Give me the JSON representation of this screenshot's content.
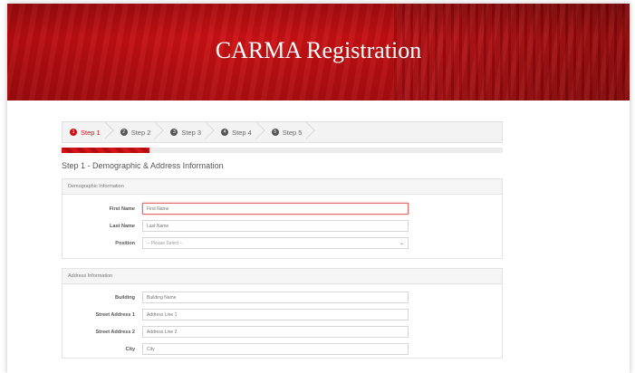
{
  "header": {
    "title": "CARMA Registration"
  },
  "steps": [
    {
      "number": "1",
      "label": "Step 1"
    },
    {
      "number": "2",
      "label": "Step 2"
    },
    {
      "number": "3",
      "label": "Step 3"
    },
    {
      "number": "4",
      "label": "Step 4"
    },
    {
      "number": "5",
      "label": "Step 5"
    }
  ],
  "progress": {
    "fraction": 0.2
  },
  "section_title": "Step 1 - Demographic & Address Information",
  "demographic": {
    "heading": "Demographic Information",
    "first_name": {
      "label": "First Name",
      "placeholder": "First Name",
      "value": ""
    },
    "last_name": {
      "label": "Last Name",
      "placeholder": "Last Name",
      "value": ""
    },
    "position": {
      "label": "Position",
      "selected": "-- Please Select --"
    }
  },
  "address": {
    "heading": "Address Information",
    "building": {
      "label": "Building",
      "placeholder": "Building Name",
      "value": ""
    },
    "street1": {
      "label": "Street Address 1",
      "placeholder": "Address Line 1",
      "value": ""
    },
    "street2": {
      "label": "Street Address 2",
      "placeholder": "Address Line 2",
      "value": ""
    },
    "city": {
      "label": "City",
      "placeholder": "City",
      "value": ""
    }
  },
  "colors": {
    "accent": "#cc1114",
    "banner": "#c20f12"
  }
}
